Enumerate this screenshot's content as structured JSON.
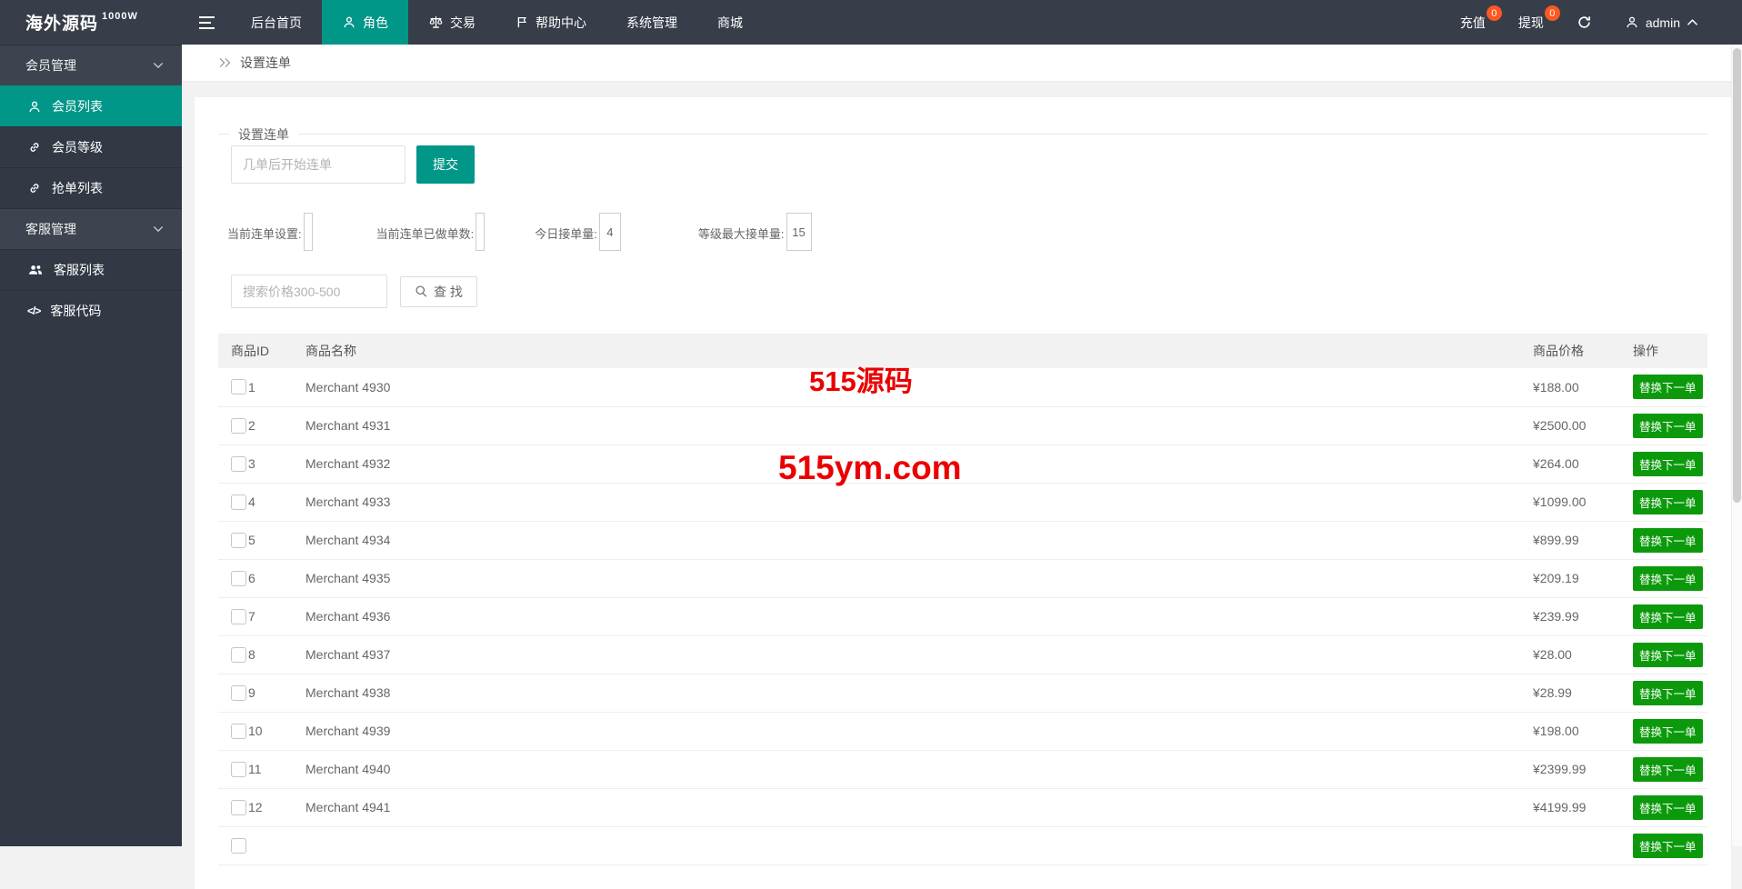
{
  "topbar": {
    "logo_text": "海外源码",
    "logo_sup": "1000W",
    "nav": [
      {
        "label": "后台首页",
        "icon": null
      },
      {
        "label": "角色",
        "icon": "user-icon",
        "active": true
      },
      {
        "label": "交易",
        "icon": "scales-icon"
      },
      {
        "label": "帮助中心",
        "icon": "flag-icon"
      },
      {
        "label": "系统管理",
        "icon": null
      },
      {
        "label": "商城",
        "icon": null
      }
    ],
    "recharge_label": "充值",
    "recharge_badge": "0",
    "withdraw_label": "提现",
    "withdraw_badge": "0",
    "username": "admin"
  },
  "sidebar": {
    "group1_label": "会员管理",
    "group1_items": [
      {
        "label": "会员列表",
        "icon": "user-icon",
        "active": true
      },
      {
        "label": "会员等级",
        "icon": "link-icon"
      },
      {
        "label": "抢单列表",
        "icon": "link-icon"
      }
    ],
    "group2_label": "客服管理",
    "group2_items": [
      {
        "label": "客服列表",
        "icon": "users-icon"
      },
      {
        "label": "客服代码",
        "icon": "code-icon"
      }
    ]
  },
  "breadcrumb": {
    "title": "设置连单"
  },
  "panel": {
    "legend": "设置连单",
    "chain_placeholder": "几单后开始连单",
    "submit_label": "提交",
    "stats": [
      {
        "label": "当前连单设置:",
        "value": ""
      },
      {
        "label": "当前连单已做单数:",
        "value": ""
      },
      {
        "label": "今日接单量:",
        "value": "4"
      },
      {
        "label": "等级最大接单量:",
        "value": "15"
      }
    ],
    "search_placeholder": "搜索价格300-500",
    "search_label": "查 找"
  },
  "watermark": {
    "line1": "515源码",
    "line2": "515ym.com"
  },
  "table": {
    "headers": [
      "商品ID",
      "商品名称",
      "商品价格",
      "操作"
    ],
    "action_label": "替换下一单",
    "rows": [
      {
        "id": "1",
        "name": "Merchant 4930",
        "price": "¥188.00"
      },
      {
        "id": "2",
        "name": "Merchant 4931",
        "price": "¥2500.00"
      },
      {
        "id": "3",
        "name": "Merchant 4932",
        "price": "¥264.00"
      },
      {
        "id": "4",
        "name": "Merchant 4933",
        "price": "¥1099.00"
      },
      {
        "id": "5",
        "name": "Merchant 4934",
        "price": "¥899.99"
      },
      {
        "id": "6",
        "name": "Merchant 4935",
        "price": "¥209.19"
      },
      {
        "id": "7",
        "name": "Merchant 4936",
        "price": "¥239.99"
      },
      {
        "id": "8",
        "name": "Merchant 4937",
        "price": "¥28.00"
      },
      {
        "id": "9",
        "name": "Merchant 4938",
        "price": "¥28.99"
      },
      {
        "id": "10",
        "name": "Merchant 4939",
        "price": "¥198.00"
      },
      {
        "id": "11",
        "name": "Merchant 4940",
        "price": "¥2399.99"
      },
      {
        "id": "12",
        "name": "Merchant 4941",
        "price": "¥4199.99"
      },
      {
        "id": "",
        "name": "",
        "price": ""
      }
    ]
  },
  "colors": {
    "accent_teal": "#009688",
    "action_green": "#0c9a0c",
    "badge_red": "#ff5722",
    "watermark_red": "#ea0000",
    "header_dark": "#373d49"
  }
}
